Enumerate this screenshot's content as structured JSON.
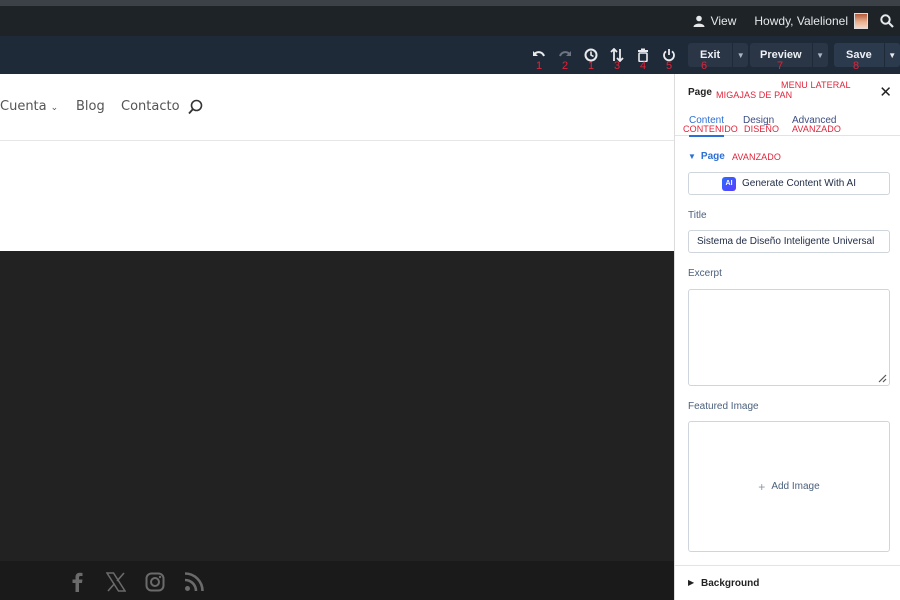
{
  "admin_bar": {
    "view_label": "View",
    "howdy_label": "Howdy, Valelionel",
    "user_icon": "user-icon",
    "search_icon": "search-icon"
  },
  "toolbar": {
    "icons": [
      {
        "name": "undo-icon",
        "number": "1"
      },
      {
        "name": "redo-icon",
        "number": "2"
      },
      {
        "name": "history-icon",
        "number": "1"
      },
      {
        "name": "sort-icon",
        "number": "3"
      },
      {
        "name": "trash-icon",
        "number": "4"
      },
      {
        "name": "power-icon",
        "number": "5"
      }
    ],
    "exit": {
      "label": "Exit",
      "number": "6"
    },
    "preview": {
      "label": "Preview",
      "number": "7"
    },
    "save": {
      "label": "Save",
      "number": "8"
    }
  },
  "site_nav": {
    "items": [
      "Cuenta",
      "Blog",
      "Contacto"
    ]
  },
  "footer": {
    "social_icons": [
      "facebook-icon",
      "x-icon",
      "instagram-icon",
      "rss-icon"
    ]
  },
  "panel": {
    "title": "Page",
    "annotations": {
      "breadcrumbs": "MIGAJAS DE PAN",
      "side_menu": "MENU LATERAL",
      "content": "CONTENIDO",
      "design": "DISEÑO",
      "advanced": "AVANZADO",
      "section": "AVANZADO"
    },
    "tabs": [
      {
        "label": "Content",
        "active": true
      },
      {
        "label": "Design",
        "active": false
      },
      {
        "label": "Advanced",
        "active": false
      }
    ],
    "section_label": "Page",
    "generate_button": "Generate Content With AI",
    "ai_badge": "AI",
    "title_label": "Title",
    "title_value": "Sistema de Diseño Inteligente Universal",
    "excerpt_label": "Excerpt",
    "excerpt_value": "",
    "featured_label": "Featured Image",
    "add_image": "Add Image",
    "background_label": "Background"
  },
  "colors": {
    "accent": "#2c6fd6",
    "annotation": "#e0243a",
    "toolbar_bg": "#1e2a38",
    "admin_bg": "#1d2327"
  }
}
